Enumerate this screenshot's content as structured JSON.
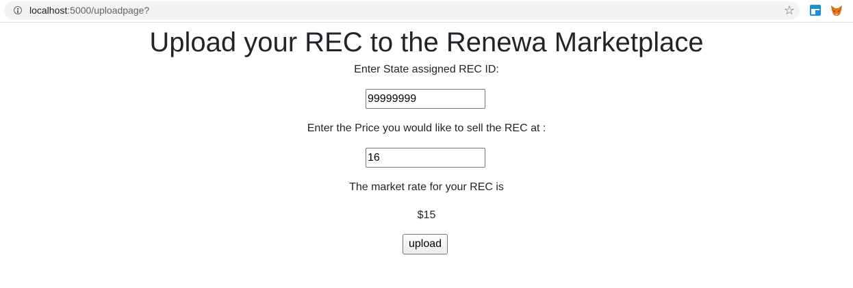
{
  "browser": {
    "url_host": "localhost",
    "url_path": ":5000/uploadpage?",
    "star_glyph": "☆"
  },
  "page": {
    "title": "Upload your REC to the Renewa Marketplace",
    "rec_id_label": "Enter State assigned REC ID:",
    "rec_id_value": "99999999",
    "price_label": "Enter the Price you would like to sell the REC at :",
    "price_value": "16",
    "market_rate_label": "The market rate for your REC is",
    "market_rate_value": "$15",
    "upload_button": "upload"
  },
  "colors": {
    "text": "#212529",
    "omnibox_bg": "#f1f3f4",
    "extension_blue": "#1a8fd6",
    "metamask_orange": "#e2761b"
  },
  "icons": [
    "info-icon",
    "star-icon",
    "extension-icon",
    "metamask-fox-icon"
  ]
}
